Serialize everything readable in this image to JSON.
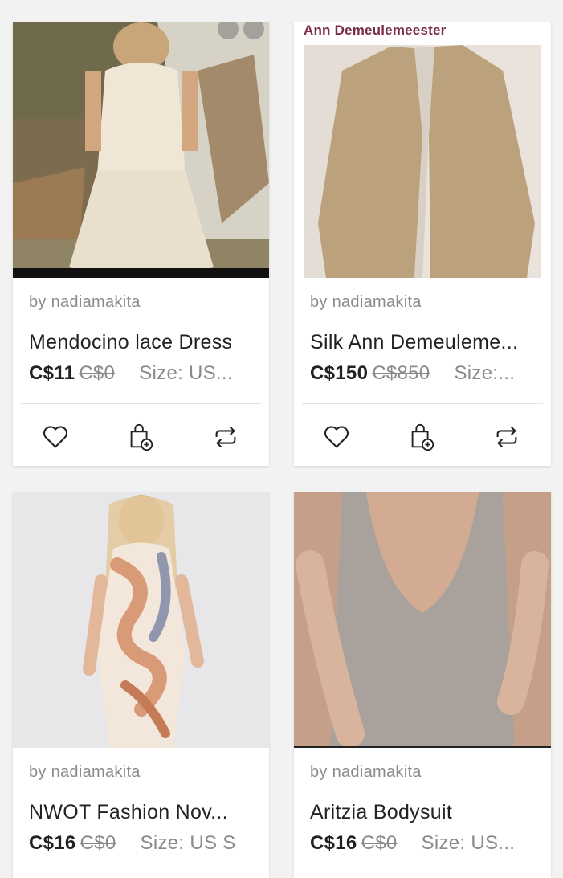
{
  "listings": [
    {
      "seller": "by nadiamakita",
      "title": "Mendocino lace Dress",
      "price": "C$11",
      "original_price": "C$0",
      "size": "Size: US...",
      "photo_colors": {
        "bg": "#8a7a5e",
        "subject": "#efe6d6"
      }
    },
    {
      "seller": "by nadiamakita",
      "title": "Silk Ann Demeuleme...",
      "price": "C$150",
      "original_price": "C$850",
      "size": "Size:...",
      "brand_tag": "Ann Demeulemeester",
      "photo_colors": {
        "bg": "#e9e3dc",
        "subject": "#bca27c"
      }
    },
    {
      "seller": "by nadiamakita",
      "title": "NWOT Fashion Nov...",
      "price": "C$16",
      "original_price": "C$0",
      "size": "Size: US S",
      "photo_colors": {
        "bg": "#e7e7e9",
        "subject": "#d99a78"
      }
    },
    {
      "seller": "by nadiamakita",
      "title": "Aritzia Bodysuit",
      "price": "C$16",
      "original_price": "C$0",
      "size": "Size: US...",
      "photo_colors": {
        "bg": "#c69f88",
        "subject": "#a9a29c"
      }
    }
  ],
  "action_icons": [
    "heart-icon",
    "bag-add-icon",
    "repost-icon"
  ]
}
